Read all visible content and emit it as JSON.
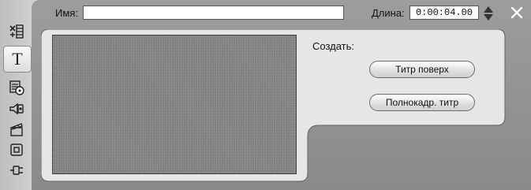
{
  "toolbar": {
    "items": [
      {
        "icon": "timeline-edit-icon"
      },
      {
        "icon": "title-text-icon",
        "glyph": "T",
        "active": true
      },
      {
        "icon": "disc-menu-icon"
      },
      {
        "icon": "audio-speaker-icon"
      },
      {
        "icon": "clapperboard-icon"
      },
      {
        "icon": "frame-icon"
      },
      {
        "icon": "plugin-icon"
      }
    ]
  },
  "titlebar": {
    "name_label": "Имя:",
    "name_value": "",
    "length_label": "Длина:",
    "length_value": "0:00:04.00"
  },
  "main": {
    "create_label": "Создать:",
    "overlay_title_button": "Титр поверх",
    "fullscreen_title_button": "Полнокадр. титр"
  },
  "colors": {
    "window_frame": "#9a9a9a",
    "panel": "#e6e6e6",
    "preview_noise": "#8c8c8c"
  }
}
